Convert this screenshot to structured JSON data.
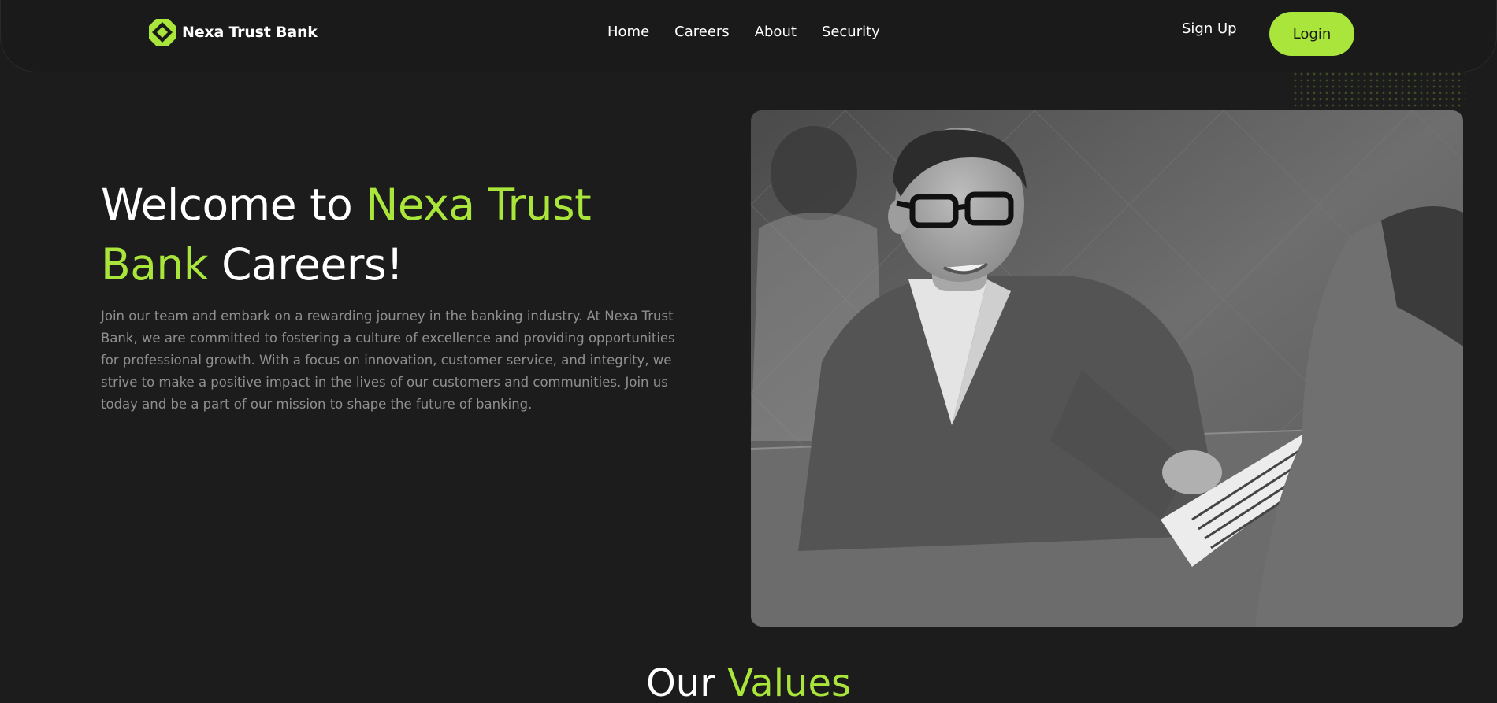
{
  "brand": {
    "name": "Nexa Trust Bank",
    "accent_color": "#a9e53a",
    "background_color": "#1c1c1c"
  },
  "nav": {
    "items": [
      {
        "label": "Home"
      },
      {
        "label": "Careers"
      },
      {
        "label": "About"
      },
      {
        "label": "Security"
      }
    ],
    "signup_label": "Sign Up",
    "login_label": "Login"
  },
  "hero": {
    "title_part1": "Welcome to ",
    "title_accent": "Nexa Trust Bank",
    "title_part2": " Careers!",
    "description": "Join our team and embark on a rewarding journey in the banking industry. At Nexa Trust Bank, we are committed to fostering a culture of excellence and providing opportunities for professional growth. With a focus on innovation, customer service, and integrity, we strive to make a positive impact in the lives of our customers and communities. Join us today and be a part of our mission to shape the future of banking."
  },
  "values": {
    "title_part1": "Our ",
    "title_accent": "Values"
  }
}
